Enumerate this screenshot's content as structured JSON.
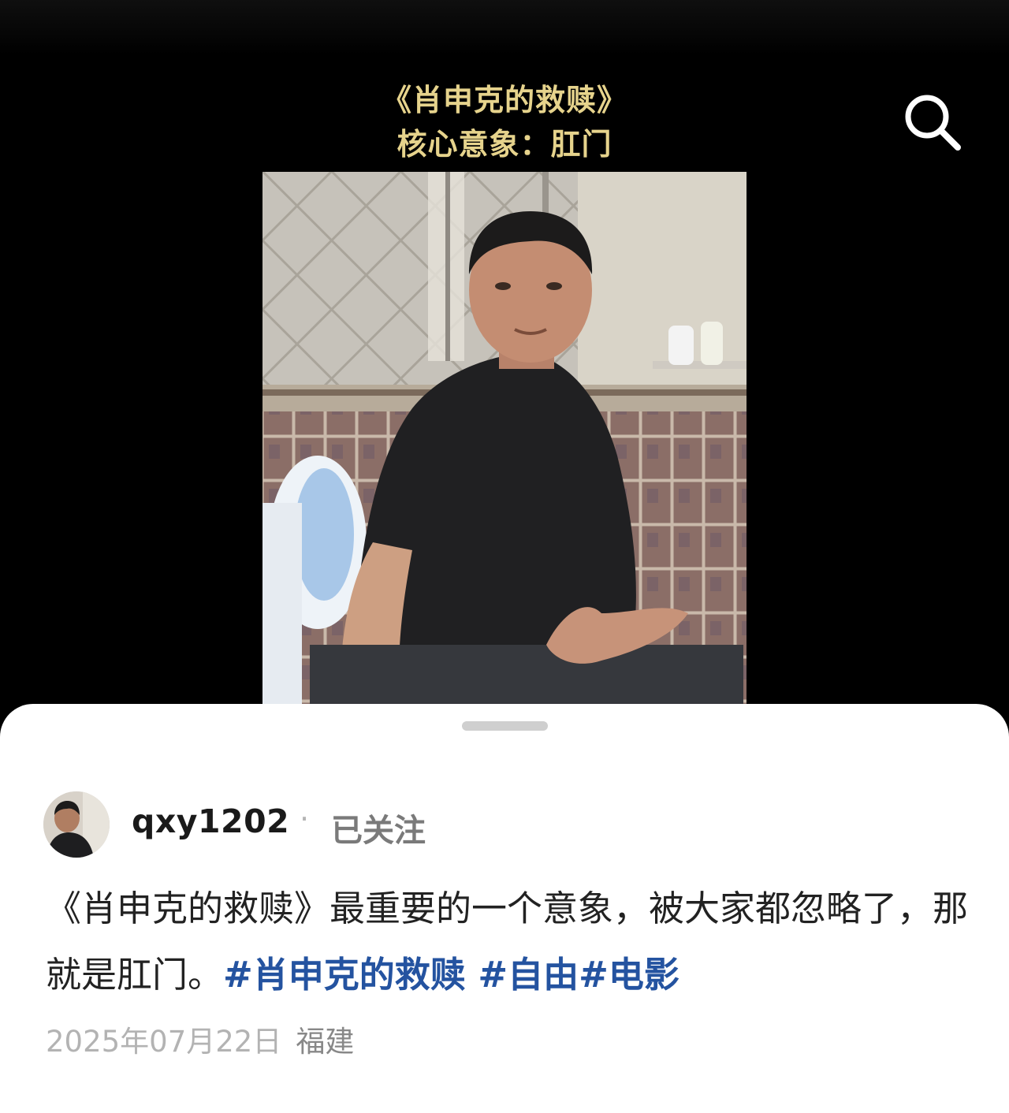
{
  "overlay": {
    "title_line1": "《肖申克的救赎》",
    "title_line2": "核心意象：肛门"
  },
  "icons": {
    "search": "search-icon",
    "avatar": "avatar"
  },
  "colors": {
    "title": "#e6d38c",
    "hashtag": "#2453a0",
    "background": "#000000",
    "sheet": "#ffffff"
  },
  "post": {
    "author": "qxy1202",
    "separator": "·",
    "follow_status": "已关注",
    "text_body": "《肖申克的救赎》最重要的一个意象，被大家都忽略了，那就是肛门。",
    "hashtags": [
      "#肖申克的救赎 ",
      "#自由",
      "#电影"
    ],
    "date": "2025年07月22日",
    "location": "福建"
  }
}
